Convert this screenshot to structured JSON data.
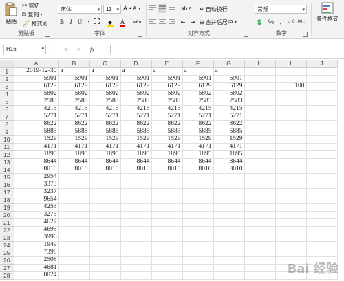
{
  "clipboard": {
    "paste_label": "粘贴",
    "cut_label": "剪切",
    "copy_label": "复制",
    "format_painter_label": "格式刷",
    "group_label": "剪贴板"
  },
  "font": {
    "family": "宋体",
    "size": "11",
    "grow": "A",
    "shrink": "A",
    "bold": "B",
    "italic": "I",
    "underline": "U",
    "wen": "wén",
    "group_label": "字体"
  },
  "alignment": {
    "wrap_label": "自动换行",
    "merge_label": "合并后居中",
    "group_label": "对齐方式"
  },
  "number": {
    "format": "常规",
    "percent": "%",
    "comma": ",",
    "group_label": "数字"
  },
  "styles": {
    "conditional_label": "条件格式"
  },
  "formula_bar": {
    "cell_ref": "H16",
    "cancel": "×",
    "confirm": "✓",
    "fx": "fx",
    "value": ""
  },
  "grid": {
    "columns": [
      "A",
      "B",
      "C",
      "D",
      "E",
      "F",
      "G",
      "H",
      "I",
      "J"
    ],
    "rows": [
      {
        "n": "1",
        "cells": [
          "2019-12-30",
          "a",
          "a",
          "a",
          "a",
          "a",
          "a",
          "",
          "",
          ""
        ]
      },
      {
        "n": "2",
        "cells": [
          "5901",
          "5901",
          "5901",
          "5901",
          "5901",
          "5901",
          "5901",
          "",
          "",
          ""
        ]
      },
      {
        "n": "3",
        "cells": [
          "6129",
          "6129",
          "6129",
          "6129",
          "6129",
          "6129",
          "6129",
          "",
          "100",
          ""
        ]
      },
      {
        "n": "4",
        "cells": [
          "5802",
          "5802",
          "5802",
          "5802",
          "5802",
          "5802",
          "5802",
          "",
          "",
          ""
        ]
      },
      {
        "n": "5",
        "cells": [
          "2583",
          "2583",
          "2583",
          "2583",
          "2583",
          "2583",
          "2583",
          "",
          "",
          ""
        ]
      },
      {
        "n": "6",
        "cells": [
          "4215",
          "4215",
          "4215",
          "4215",
          "4215",
          "4215",
          "4215",
          "",
          "",
          ""
        ]
      },
      {
        "n": "7",
        "cells": [
          "5271",
          "5271",
          "5271",
          "5271",
          "5271",
          "5271",
          "5271",
          "",
          "",
          ""
        ]
      },
      {
        "n": "8",
        "cells": [
          "8622",
          "8622",
          "8622",
          "8622",
          "8622",
          "8622",
          "8622",
          "",
          "",
          ""
        ]
      },
      {
        "n": "9",
        "cells": [
          "5885",
          "5885",
          "5885",
          "5885",
          "5885",
          "5885",
          "5885",
          "",
          "",
          ""
        ]
      },
      {
        "n": "10",
        "cells": [
          "1529",
          "1529",
          "1529",
          "1529",
          "1529",
          "1529",
          "1529",
          "",
          "",
          ""
        ]
      },
      {
        "n": "11",
        "cells": [
          "4171",
          "4171",
          "4171",
          "4171",
          "4171",
          "4171",
          "4171",
          "",
          "",
          ""
        ]
      },
      {
        "n": "12",
        "cells": [
          "1895",
          "1895",
          "1895",
          "1895",
          "1895",
          "1895",
          "1895",
          "",
          "",
          ""
        ]
      },
      {
        "n": "13",
        "cells": [
          "8644",
          "8644",
          "8644",
          "8644",
          "8644",
          "8644",
          "8644",
          "",
          "",
          ""
        ]
      },
      {
        "n": "14",
        "cells": [
          "8010",
          "8010",
          "8010",
          "8010",
          "8010",
          "8010",
          "8010",
          "",
          "",
          ""
        ]
      },
      {
        "n": "15",
        "cells": [
          "2954",
          "",
          "",
          "",
          "",
          "",
          "",
          "",
          "",
          ""
        ]
      },
      {
        "n": "16",
        "cells": [
          "3373",
          "",
          "",
          "",
          "",
          "",
          "",
          "",
          "",
          ""
        ]
      },
      {
        "n": "17",
        "cells": [
          "3237",
          "",
          "",
          "",
          "",
          "",
          "",
          "",
          "",
          ""
        ]
      },
      {
        "n": "18",
        "cells": [
          "9654",
          "",
          "",
          "",
          "",
          "",
          "",
          "",
          "",
          ""
        ]
      },
      {
        "n": "19",
        "cells": [
          "4253",
          "",
          "",
          "",
          "",
          "",
          "",
          "",
          "",
          ""
        ]
      },
      {
        "n": "20",
        "cells": [
          "3275",
          "",
          "",
          "",
          "",
          "",
          "",
          "",
          "",
          ""
        ]
      },
      {
        "n": "21",
        "cells": [
          "4627",
          "",
          "",
          "",
          "",
          "",
          "",
          "",
          "",
          ""
        ]
      },
      {
        "n": "22",
        "cells": [
          "4695",
          "",
          "",
          "",
          "",
          "",
          "",
          "",
          "",
          ""
        ]
      },
      {
        "n": "23",
        "cells": [
          "3996",
          "",
          "",
          "",
          "",
          "",
          "",
          "",
          "",
          ""
        ]
      },
      {
        "n": "24",
        "cells": [
          "1949",
          "",
          "",
          "",
          "",
          "",
          "",
          "",
          "",
          ""
        ]
      },
      {
        "n": "25",
        "cells": [
          "7398",
          "",
          "",
          "",
          "",
          "",
          "",
          "",
          "",
          ""
        ]
      },
      {
        "n": "26",
        "cells": [
          "2508",
          "",
          "",
          "",
          "",
          "",
          "",
          "",
          "",
          ""
        ]
      },
      {
        "n": "27",
        "cells": [
          "4681",
          "",
          "",
          "",
          "",
          "",
          "",
          "",
          "",
          ""
        ]
      },
      {
        "n": "28",
        "cells": [
          "0024",
          "",
          "",
          "",
          "",
          "",
          "",
          "",
          "",
          ""
        ]
      }
    ]
  },
  "watermark": "Bai 经验"
}
